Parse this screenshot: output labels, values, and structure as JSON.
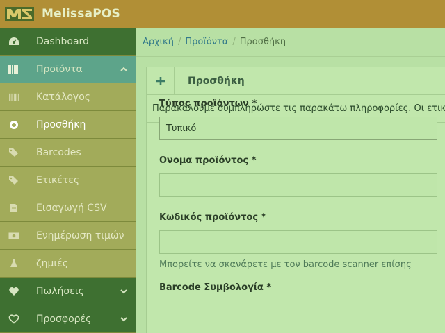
{
  "app": {
    "brand": "MelissaPOS"
  },
  "colors": {
    "topbar": "#b18f36",
    "sidebar_dark": "#3e7031",
    "sidebar_active": "#5da48a",
    "sidebar_sub": "#a2ab5a",
    "content_bg": "#b8e0a4",
    "link": "#337a8a"
  },
  "sidebar": {
    "items": [
      {
        "label": "Dashboard",
        "icon": "dashboard-icon"
      },
      {
        "label": "Προϊόντα",
        "icon": "barcode-icon"
      },
      {
        "label": "Κατάλογος",
        "icon": "barcode-icon"
      },
      {
        "label": "Προσθήκη",
        "icon": "plus-circle-icon"
      },
      {
        "label": "Barcodes",
        "icon": "tags-icon"
      },
      {
        "label": "Ετικέτες",
        "icon": "tags-icon"
      },
      {
        "label": "Εισαγωγή CSV",
        "icon": "file-icon"
      },
      {
        "label": "Ενημέρωση τιμών",
        "icon": "money-icon"
      },
      {
        "label": "ζημιές",
        "icon": "flask-icon"
      },
      {
        "label": "Πωλήσεις",
        "icon": "heart-icon"
      },
      {
        "label": "Προσφορές",
        "icon": "heart-outline-icon"
      }
    ]
  },
  "breadcrumb": {
    "home": "Αρχική",
    "section": "Προϊόντα",
    "current": "Προσθήκη",
    "separator": "/"
  },
  "panel": {
    "plus": "+",
    "title": "Προσθήκη",
    "intro": "Παρακαλούμε συμπληρώστε τις παρακάτω πληροφορίες. Οι ετικέτ"
  },
  "form": {
    "type_label": "Τύπος προϊόντων *",
    "type_value": "Τυπικό",
    "name_label": "Ονομα προϊόντος *",
    "name_value": "",
    "code_label": "Κωδικός προϊόντος *",
    "code_value": "",
    "code_help": "Μπορείτε να σκανάρετε με τον barcode scanner επίσης",
    "barcode_label": "Barcode Συμβολογία *"
  }
}
